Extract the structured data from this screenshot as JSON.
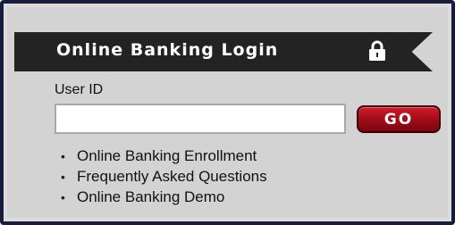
{
  "login_panel": {
    "title": "Online Banking Login",
    "title_icon": "lock-icon",
    "user_id_label": "User ID",
    "user_id_value": "",
    "user_id_placeholder": "",
    "go_label": "GO",
    "links": [
      {
        "bullet": "•",
        "label": "Online Banking Enrollment"
      },
      {
        "bullet": "•",
        "label": "Frequently Asked Questions"
      },
      {
        "bullet": "•",
        "label": "Online Banking Demo"
      }
    ]
  },
  "colors": {
    "frame_border": "#1a1c3c",
    "panel_background": "#d3d3d3",
    "banner_background": "#232323",
    "go_button": "#b01020"
  }
}
